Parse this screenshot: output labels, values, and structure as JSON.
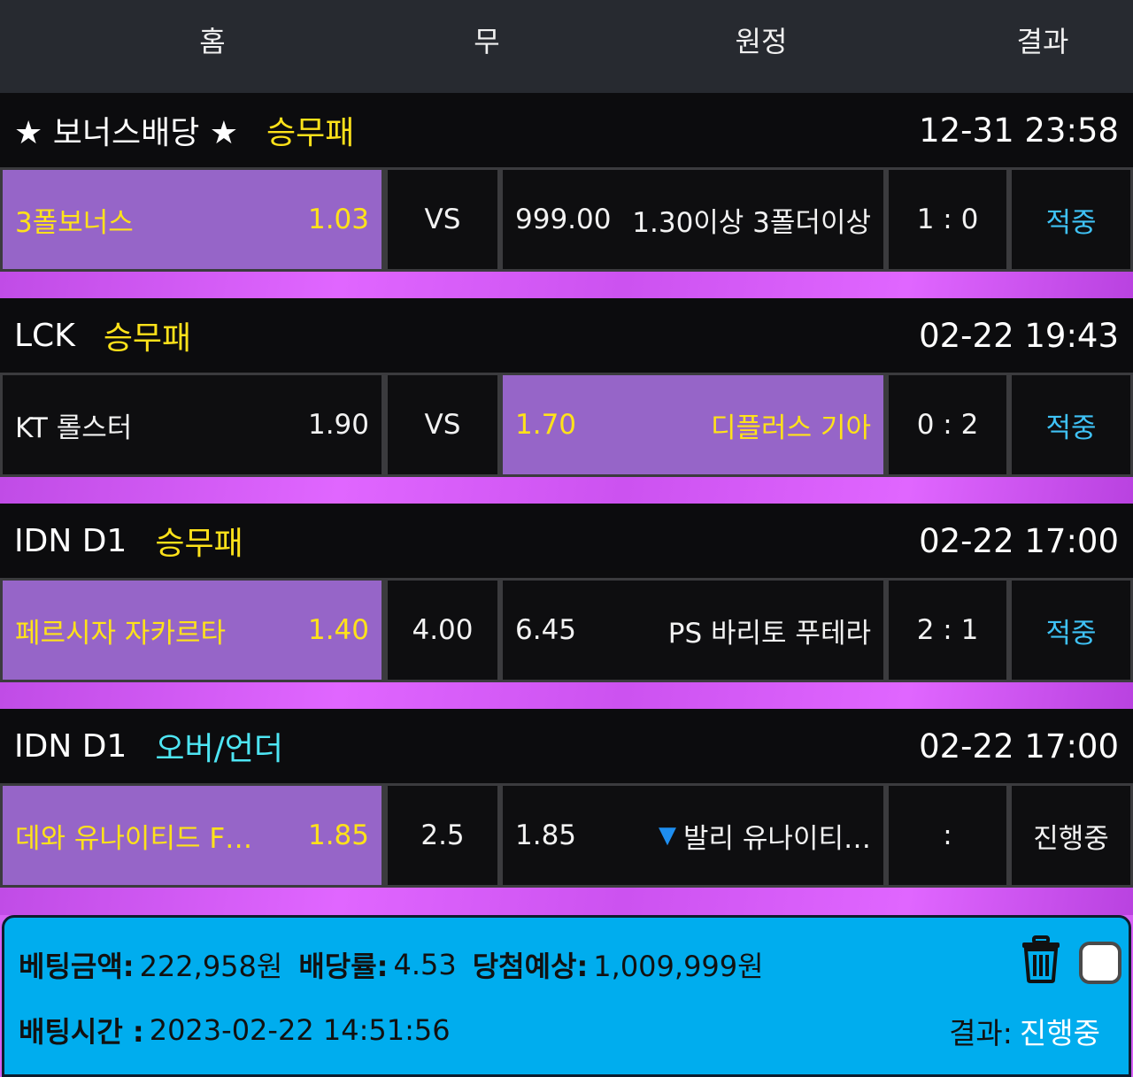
{
  "header": {
    "home": "홈",
    "draw": "무",
    "away": "원정",
    "result": "결과"
  },
  "colors": {
    "selected": "#9665c8",
    "market_yellow": "#ffe21a",
    "market_cyan": "#4ee6f4",
    "hit": "#3fc2f6",
    "footer_bg": "#00adee"
  },
  "groups": [
    {
      "league": "★ 보너스배당 ★",
      "market": "승무패",
      "market_color": "#ffe21a",
      "time": "12-31 23:58",
      "home": "3폴보너스",
      "home_odds": "1.03",
      "draw": "VS",
      "away_odds": "999.00",
      "away": "1.30이상 3폴더이상",
      "score": "1 : 0",
      "result": "적중",
      "selected": "home"
    },
    {
      "league": "LCK",
      "market": "승무패",
      "market_color": "#ffe21a",
      "time": "02-22 19:43",
      "home": "KT 롤스터",
      "home_odds": "1.90",
      "draw": "VS",
      "away_odds": "1.70",
      "away": "디플러스 기아",
      "score": "0 : 2",
      "result": "적중",
      "selected": "away"
    },
    {
      "league": "IDN D1",
      "market": "승무패",
      "market_color": "#ffe21a",
      "time": "02-22 17:00",
      "home": "페르시자 자카르타",
      "home_odds": "1.40",
      "draw": "4.00",
      "away_odds": "6.45",
      "away": "PS 바리토 푸테라",
      "score": "2 : 1",
      "result": "적중",
      "selected": "home"
    },
    {
      "league": "IDN D1",
      "market": "오버/언더",
      "market_color": "#4ee6f4",
      "time": "02-22 17:00",
      "home": "데와 유나이티드 F…",
      "home_odds": "1.85",
      "draw": "2.5",
      "away_odds": "1.85",
      "away": "발리 유나이티…",
      "away_icon": "down-triangle-icon",
      "score": ":",
      "result": "진행중",
      "selected": "home"
    }
  ],
  "footer": {
    "bet_amount_label": "베팅금액:",
    "bet_amount": "222,958원",
    "odds_label": "배당률:",
    "odds": "4.53",
    "expected_label": "당첨예상:",
    "expected": "1,009,999원",
    "time_label": "배팅시간 :",
    "time": "2023-02-22 14:51:56",
    "result_label": "결과:",
    "result": "진행중",
    "trash_icon": "trash-icon",
    "checkbox_checked": false
  }
}
